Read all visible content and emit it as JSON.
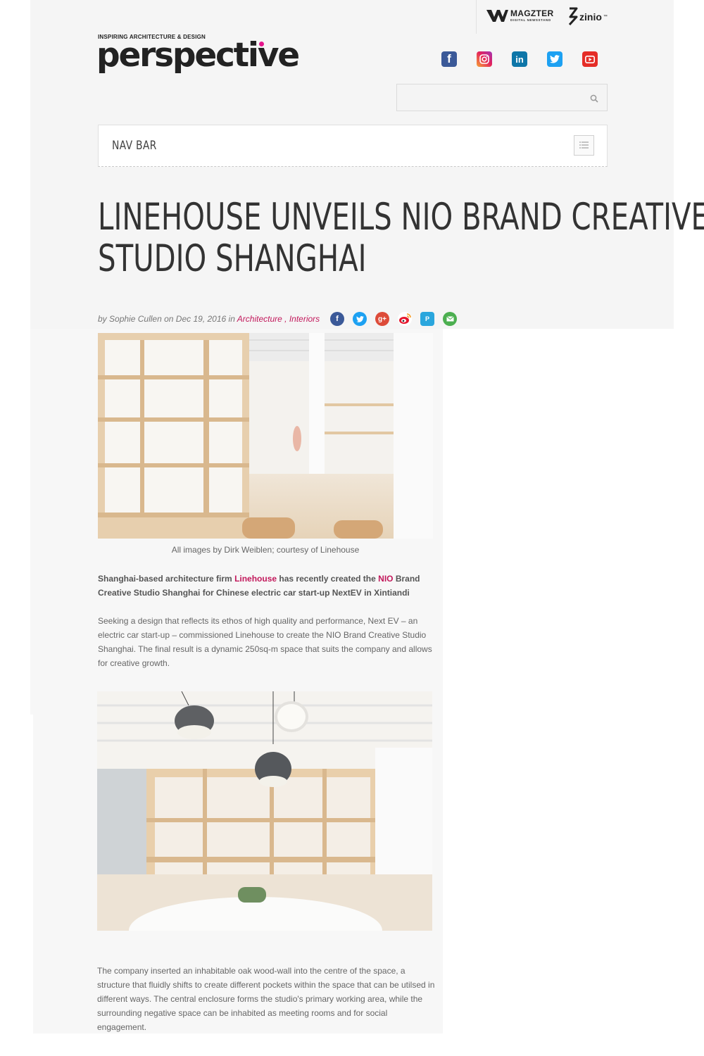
{
  "partners": {
    "magzter_name": "MAGZTER",
    "magzter_sub": "DIGITAL NEWSSTAND",
    "zinio_name": "zinio",
    "zinio_tm": "™"
  },
  "header": {
    "tagline": "INSPIRING ARCHITECTURE & DESIGN",
    "logo": "perspective",
    "accent_color": "#e5168c"
  },
  "social": [
    {
      "name": "facebook-icon",
      "glyph": "f",
      "color": "#3b5998"
    },
    {
      "name": "instagram-icon",
      "glyph": "",
      "color": "#e3215c"
    },
    {
      "name": "linkedin-icon",
      "glyph": "in",
      "color": "#0e76a8"
    },
    {
      "name": "twitter-icon",
      "glyph": "",
      "color": "#1da1f2"
    },
    {
      "name": "youtube-icon",
      "glyph": "",
      "color": "#e52d27"
    }
  ],
  "search": {
    "placeholder": ""
  },
  "nav": {
    "label": "NAV BAR"
  },
  "article": {
    "title_line1": "LINEHOUSE UNVEILS NIO BRAND CREATIVE",
    "title_line2": "STUDIO SHANGHAI",
    "meta": {
      "by": "by",
      "author": "Sophie Cullen",
      "on": "on",
      "date": "Dec 19, 2016",
      "in": "in",
      "category1": "Architecture",
      "separator": " , ",
      "category2": "Interiors"
    },
    "share_icons": [
      "facebook-share-icon",
      "twitter-share-icon",
      "google-plus-share-icon",
      "weibo-share-icon",
      "pocket-share-icon",
      "email-share-icon"
    ],
    "caption": "All images by Dirk Weiblen; courtesy of Linehouse",
    "lead": {
      "part1": "Shanghai-based architecture firm ",
      "link1": "Linehouse",
      "part2": " has recently created the ",
      "link2": "NIO",
      "part3": " Brand Creative Studio Shanghai for Chinese electric car start-up NextEV in Xintiandi"
    },
    "paragraph1": "Seeking a design that reflects its ethos of high quality and performance, Next EV – an electric car start-up – commissioned Linehouse to create the NIO Brand Creative Studio Shanghai. The final result is a dynamic 250sq-m space that suits the company and allows for creative growth.",
    "paragraph2": "The company inserted an inhabitable oak wood-wall into the centre of the space, a structure that fluidly shifts to create different pockets within the space that can be utilsed in different ways. The central enclosure forms the studio's primary working area, while the surrounding negative space can be inhabited as meeting rooms and for social engagement."
  }
}
